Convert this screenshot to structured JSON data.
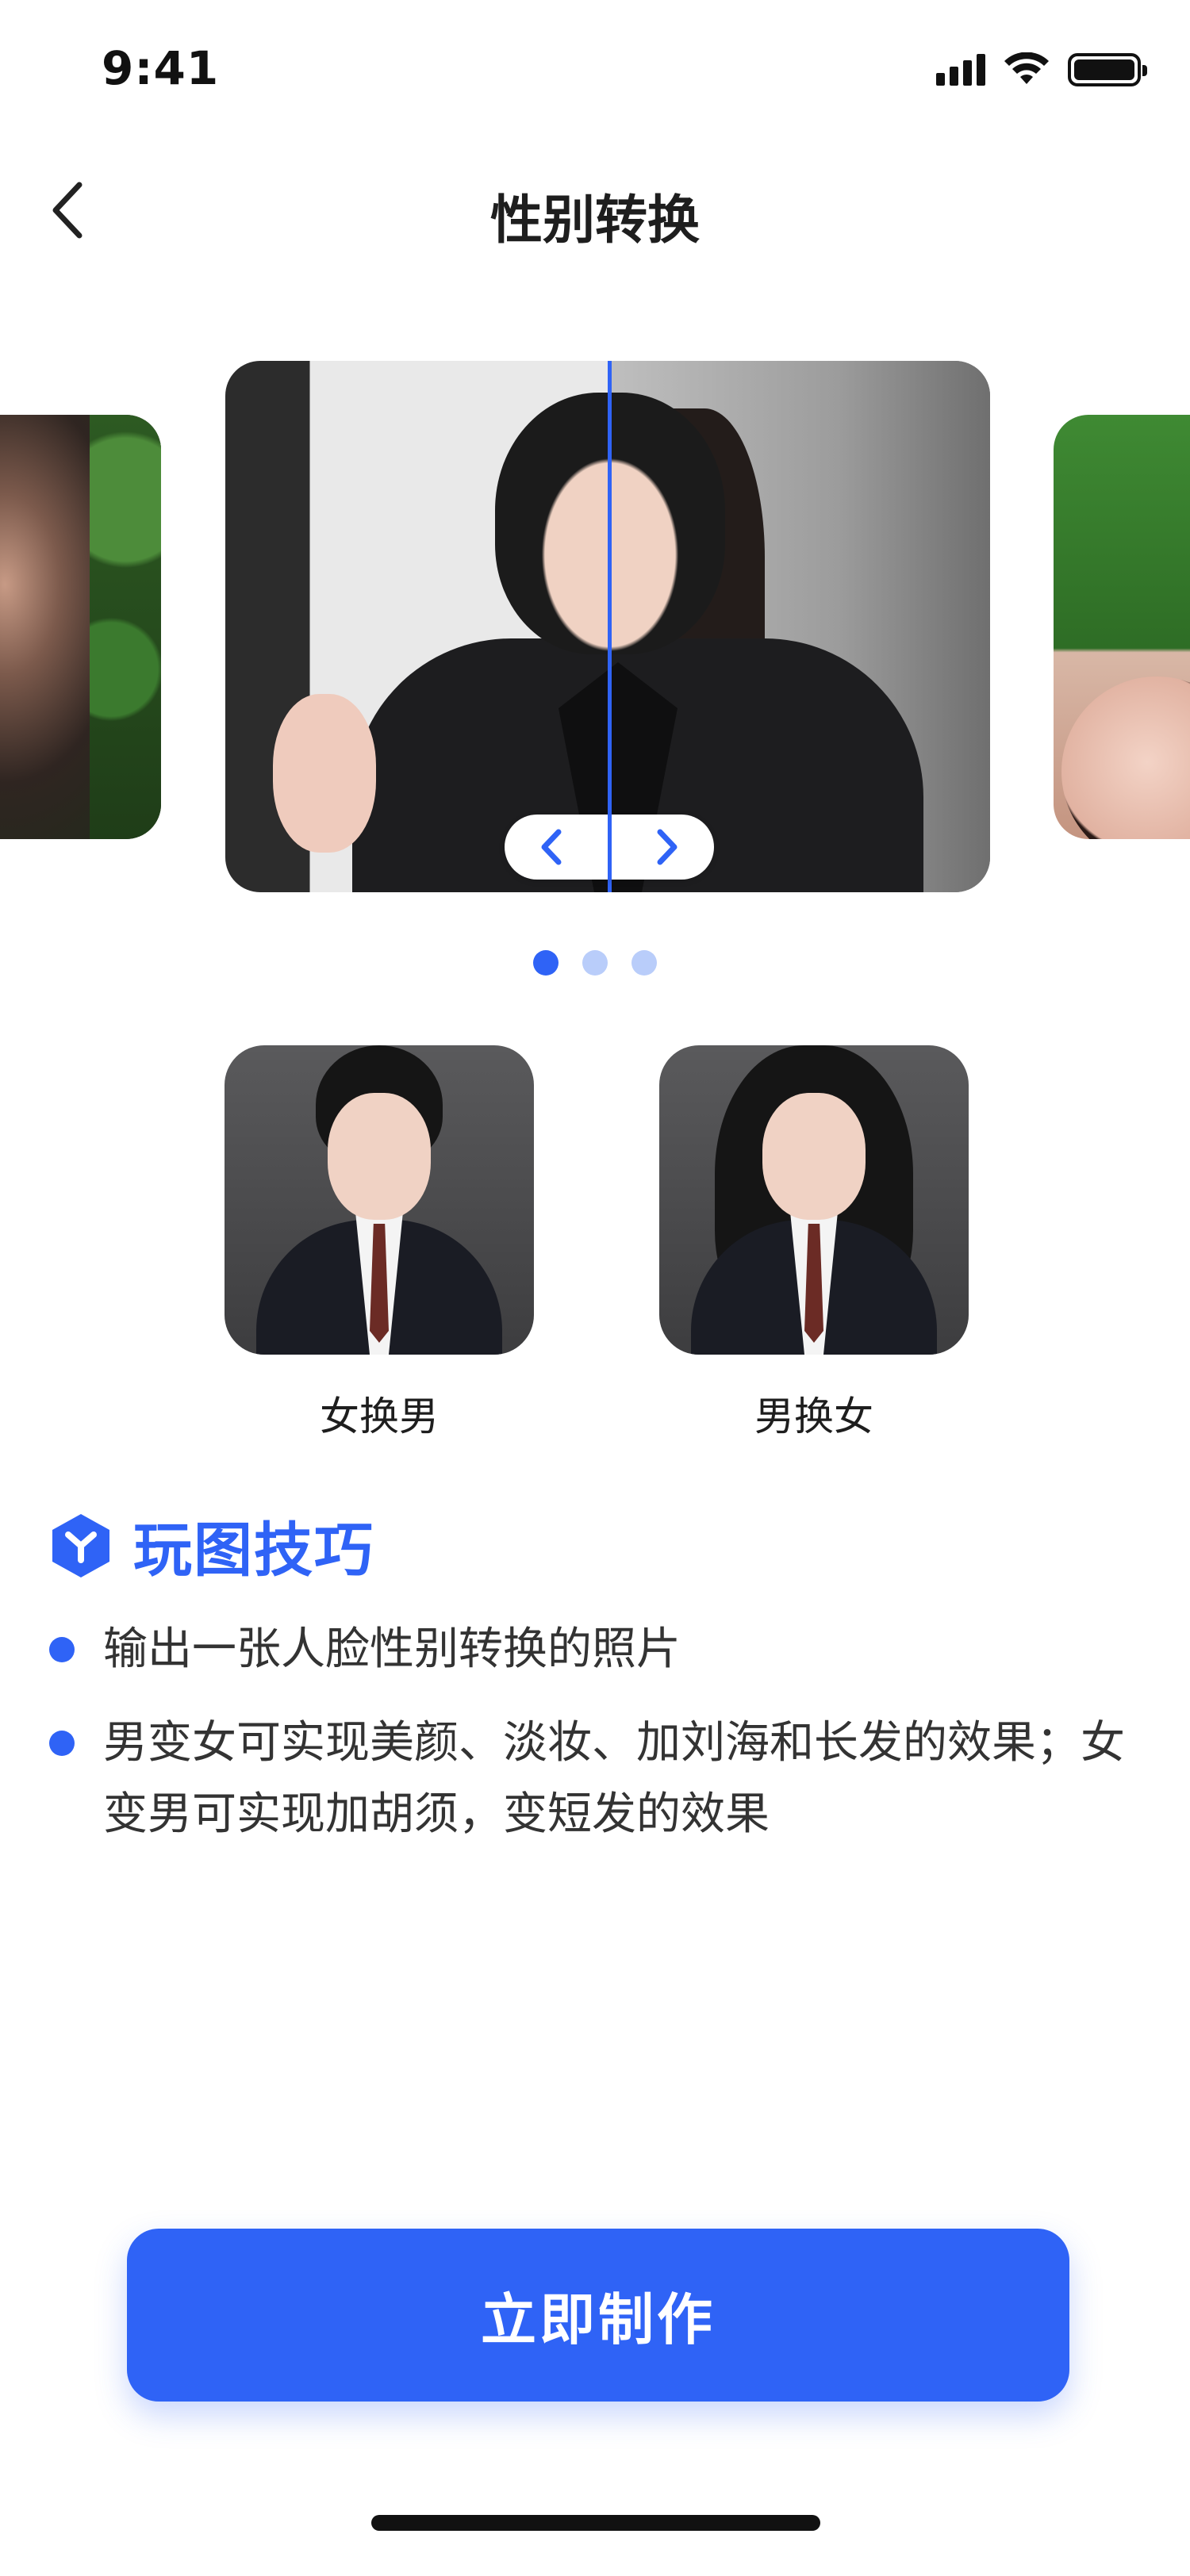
{
  "status_bar": {
    "time": "9:41",
    "signal_icon": "cellular-signal-icon",
    "wifi_icon": "wifi-icon",
    "battery_icon": "battery-icon"
  },
  "nav": {
    "back_icon": "chevron-left-icon",
    "title": "性别转换"
  },
  "carousel": {
    "active_index": 0,
    "page_count": 3,
    "left_arrow_icon": "chevron-left-icon",
    "right_arrow_icon": "chevron-right-icon"
  },
  "modes": [
    {
      "label": "女换男"
    },
    {
      "label": "男换女"
    }
  ],
  "tips": {
    "icon": "hexagon-y-logo-icon",
    "title": "玩图技巧",
    "items": [
      "输出一张人脸性别转换的照片",
      "男变女可实现美颜、淡妆、加刘海和长发的效果；女变男可实现加胡须，变短发的效果"
    ]
  },
  "cta": {
    "label": "立即制作"
  },
  "colors": {
    "accent": "#2f63f6",
    "pager_inactive": "#b9cdfa",
    "text": "#222222"
  }
}
